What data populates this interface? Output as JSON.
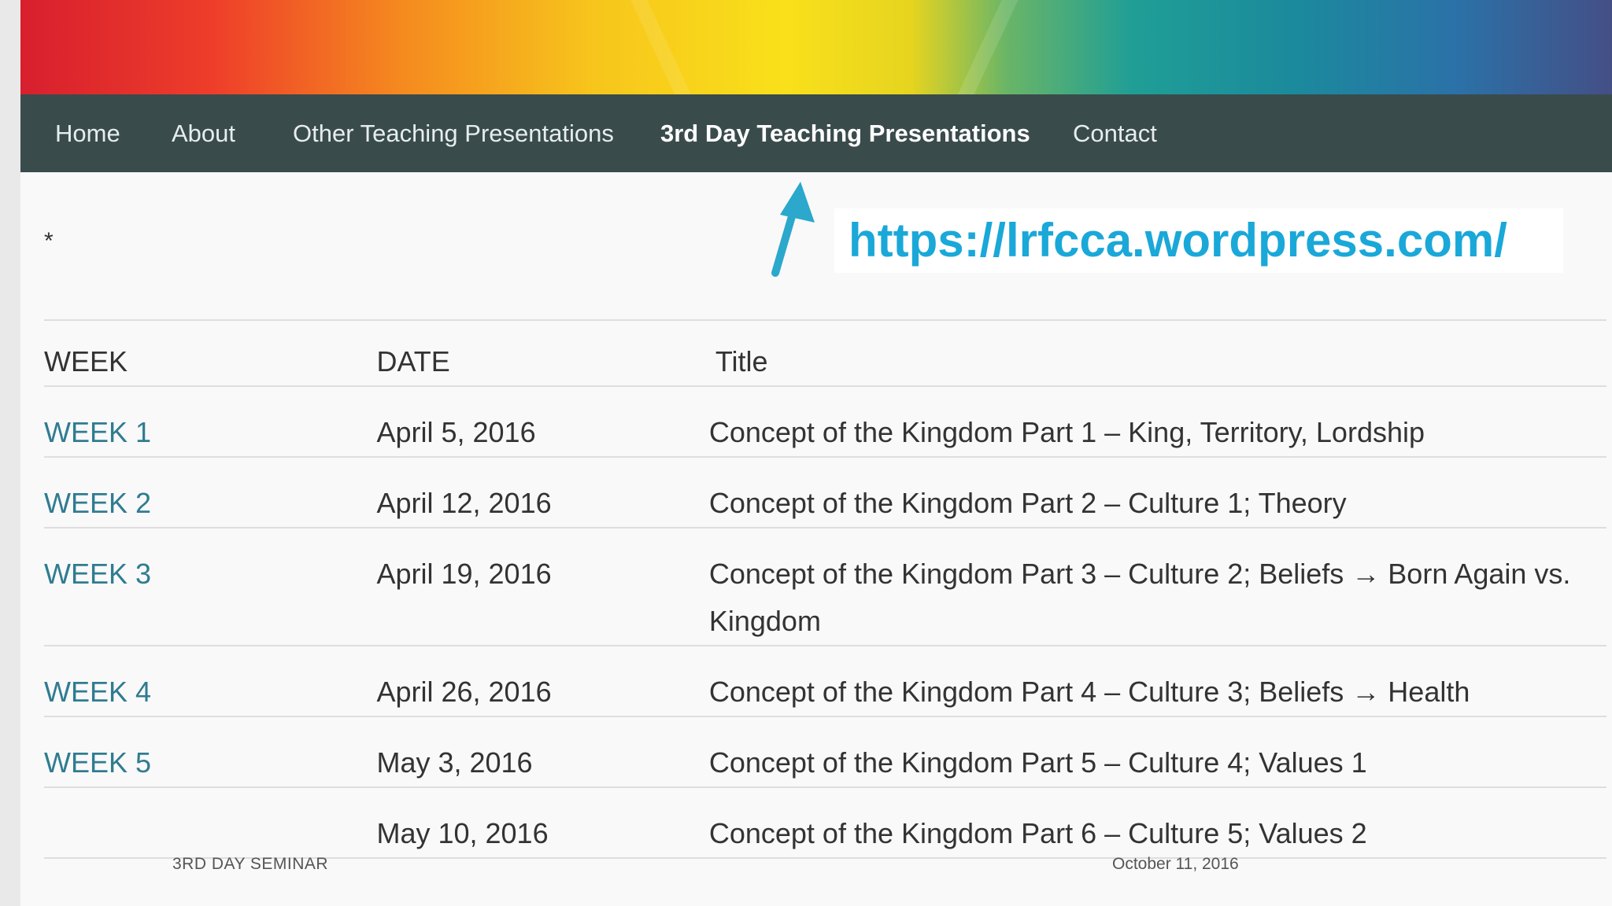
{
  "nav": {
    "items": [
      {
        "label": "Home"
      },
      {
        "label": "About"
      },
      {
        "label": "Other Teaching Presentations"
      },
      {
        "label": "3rd Day Teaching Presentations"
      },
      {
        "label": "Contact"
      }
    ]
  },
  "marker": "*",
  "callout": {
    "url": "https://lrfcca.wordpress.com/",
    "arrow_icon": "up-arrow-icon",
    "color": "#1aa8d8"
  },
  "table": {
    "headers": {
      "week": "WEEK",
      "date": "DATE",
      "title": "Title"
    },
    "rows": [
      {
        "week": "WEEK 1",
        "date": "April 5, 2016",
        "title": "Concept of the Kingdom Part 1 – King, Territory, Lordship"
      },
      {
        "week": "WEEK 2",
        "date": "April 12, 2016",
        "title": "Concept of the Kingdom Part 2 – Culture 1; Theory"
      },
      {
        "week": "WEEK 3",
        "date": "April 19, 2016",
        "title": "Concept of the Kingdom Part 3 – Culture 2; Beliefs → Born Again vs. Kingdom"
      },
      {
        "week": "WEEK 4",
        "date": "April 26, 2016",
        "title": "Concept of the Kingdom Part 4 – Culture 3; Beliefs → Health"
      },
      {
        "week": "WEEK 5",
        "date": "May 3, 2016",
        "title": "Concept of the Kingdom Part 5 – Culture 4; Values 1"
      },
      {
        "week": "",
        "date": "May 10, 2016",
        "title": "Concept of the Kingdom Part 6 – Culture 5; Values 2"
      }
    ]
  },
  "footer": {
    "left": "3RD DAY SEMINAR",
    "right": "October 11, 2016"
  },
  "colors": {
    "nav_bg": "#3a4b4c",
    "link": "#2f7c91"
  }
}
